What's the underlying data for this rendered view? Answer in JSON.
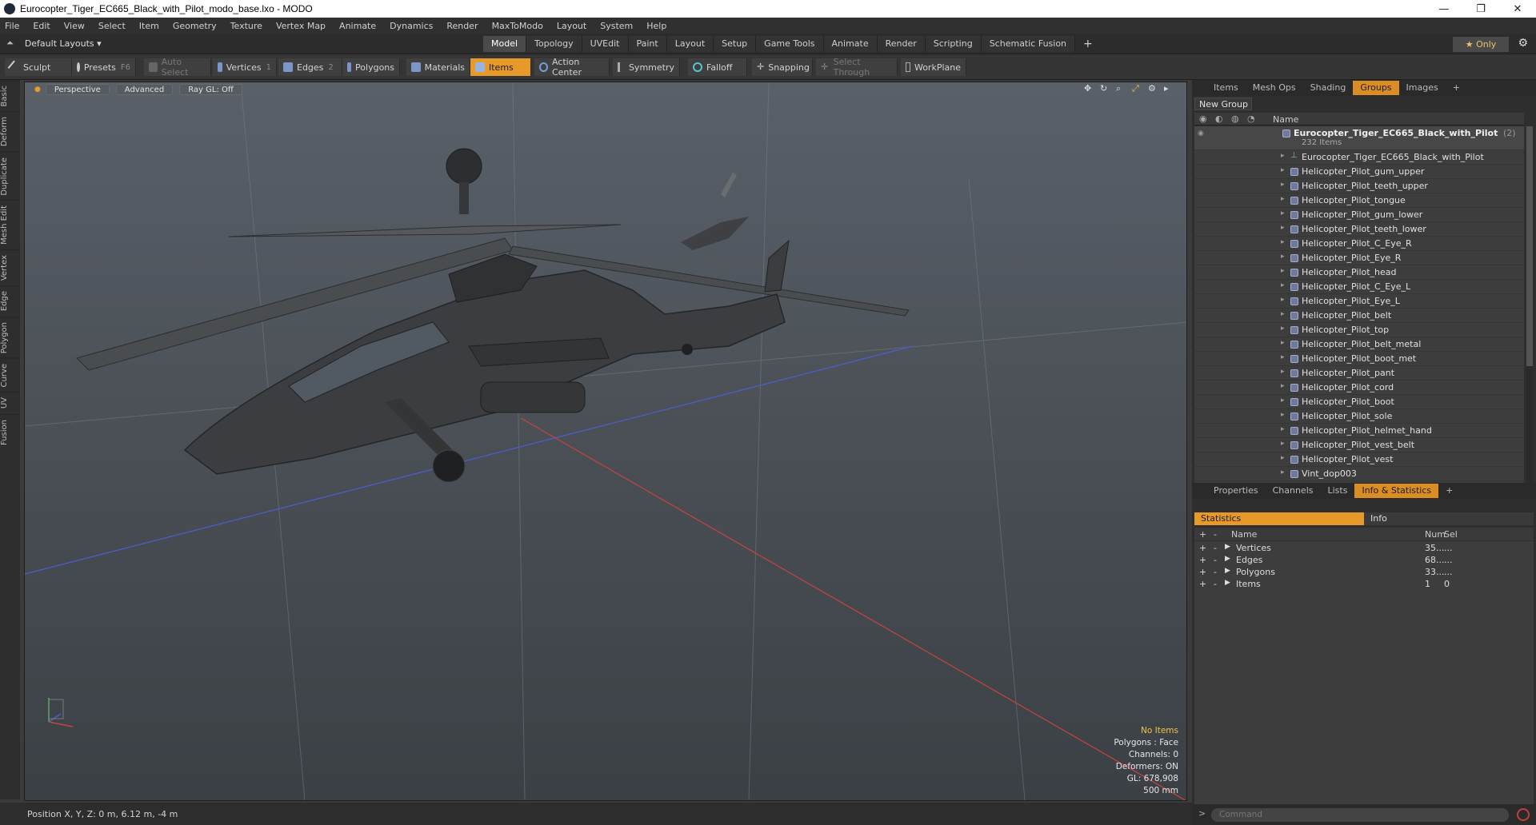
{
  "window": {
    "title": "Eurocopter_Tiger_EC665_Black_with_Pilot_modo_base.lxo - MODO",
    "minimize": "—",
    "maximize": "❐",
    "close": "✕"
  },
  "menu": [
    "File",
    "Edit",
    "View",
    "Select",
    "Item",
    "Geometry",
    "Texture",
    "Vertex Map",
    "Animate",
    "Dynamics",
    "Render",
    "MaxToModo",
    "Layout",
    "System",
    "Help"
  ],
  "layout": {
    "preset": "Default Layouts ▾",
    "tabs": [
      "Model",
      "Topology",
      "UVEdit",
      "Paint",
      "Layout",
      "Setup",
      "Game Tools",
      "Animate",
      "Render",
      "Scripting",
      "Schematic Fusion",
      "+"
    ],
    "active_tab": "Model",
    "only_label": "★  Only"
  },
  "toolbar": {
    "sculpt": "Sculpt",
    "presets": "Presets",
    "presets_key": "F6",
    "auto_select": "Auto Select",
    "vertices": "Vertices",
    "vertices_key": "1",
    "edges": "Edges",
    "edges_key": "2",
    "polygons": "Polygons",
    "materials": "Materials",
    "items": "Items",
    "action_center": "Action Center",
    "symmetry": "Symmetry",
    "falloff": "Falloff",
    "snapping": "Snapping",
    "select_through": "Select Through",
    "workplane": "WorkPlane"
  },
  "left_tabs": [
    "Basic",
    "Deform",
    "Duplicate",
    "Mesh Edit",
    "Vertex",
    "Edge",
    "Polygon",
    "Curve",
    "UV",
    "Fusion"
  ],
  "viewport": {
    "view": "Perspective",
    "shading": "Advanced",
    "raygl": "Ray GL: Off",
    "info": {
      "no_items": "No Items",
      "polygons": "Polygons : Face",
      "channels": "Channels: 0",
      "deformers": "Deformers: ON",
      "gl": "GL: 678,908",
      "scale": "500 mm"
    }
  },
  "status": {
    "position": "Position X, Y, Z:   0 m, 6.12 m, -4 m"
  },
  "panel_top": {
    "tabs": [
      "Items",
      "Mesh Ops",
      "Shading",
      "Groups",
      "Images",
      "+"
    ],
    "active": "Groups",
    "new_group": "New Group",
    "col_name": "Name",
    "root": {
      "name": "Eurocopter_Tiger_EC665_Black_with_Pilot",
      "count": "(2)",
      "sub": "232 Items"
    },
    "items": [
      "Eurocopter_Tiger_EC665_Black_with_Pilot",
      "Helicopter_Pilot_gum_upper",
      "Helicopter_Pilot_teeth_upper",
      "Helicopter_Pilot_tongue",
      "Helicopter_Pilot_gum_lower",
      "Helicopter_Pilot_teeth_lower",
      "Helicopter_Pilot_C_Eye_R",
      "Helicopter_Pilot_Eye_R",
      "Helicopter_Pilot_head",
      "Helicopter_Pilot_C_Eye_L",
      "Helicopter_Pilot_Eye_L",
      "Helicopter_Pilot_belt",
      "Helicopter_Pilot_top",
      "Helicopter_Pilot_belt_metal",
      "Helicopter_Pilot_boot_met",
      "Helicopter_Pilot_pant",
      "Helicopter_Pilot_cord",
      "Helicopter_Pilot_boot",
      "Helicopter_Pilot_sole",
      "Helicopter_Pilot_helmet_hand",
      "Helicopter_Pilot_vest_belt",
      "Helicopter_Pilot_vest",
      "Vint_dop003"
    ]
  },
  "panel_bottom": {
    "tabs": [
      "Properties",
      "Channels",
      "Lists",
      "Info & Statistics",
      "+"
    ],
    "active": "Info & Statistics",
    "sub_tabs": [
      "Statistics",
      "Info"
    ],
    "cols": {
      "name": "Name",
      "num": "Num",
      "sel": "Sel"
    },
    "rows": [
      {
        "name": "Vertices",
        "num": "35...",
        "sel": "..."
      },
      {
        "name": "Edges",
        "num": "68...",
        "sel": "..."
      },
      {
        "name": "Polygons",
        "num": "33...",
        "sel": "..."
      },
      {
        "name": "Items",
        "num": "1",
        "sel": "0"
      }
    ],
    "command_placeholder": "Command"
  }
}
